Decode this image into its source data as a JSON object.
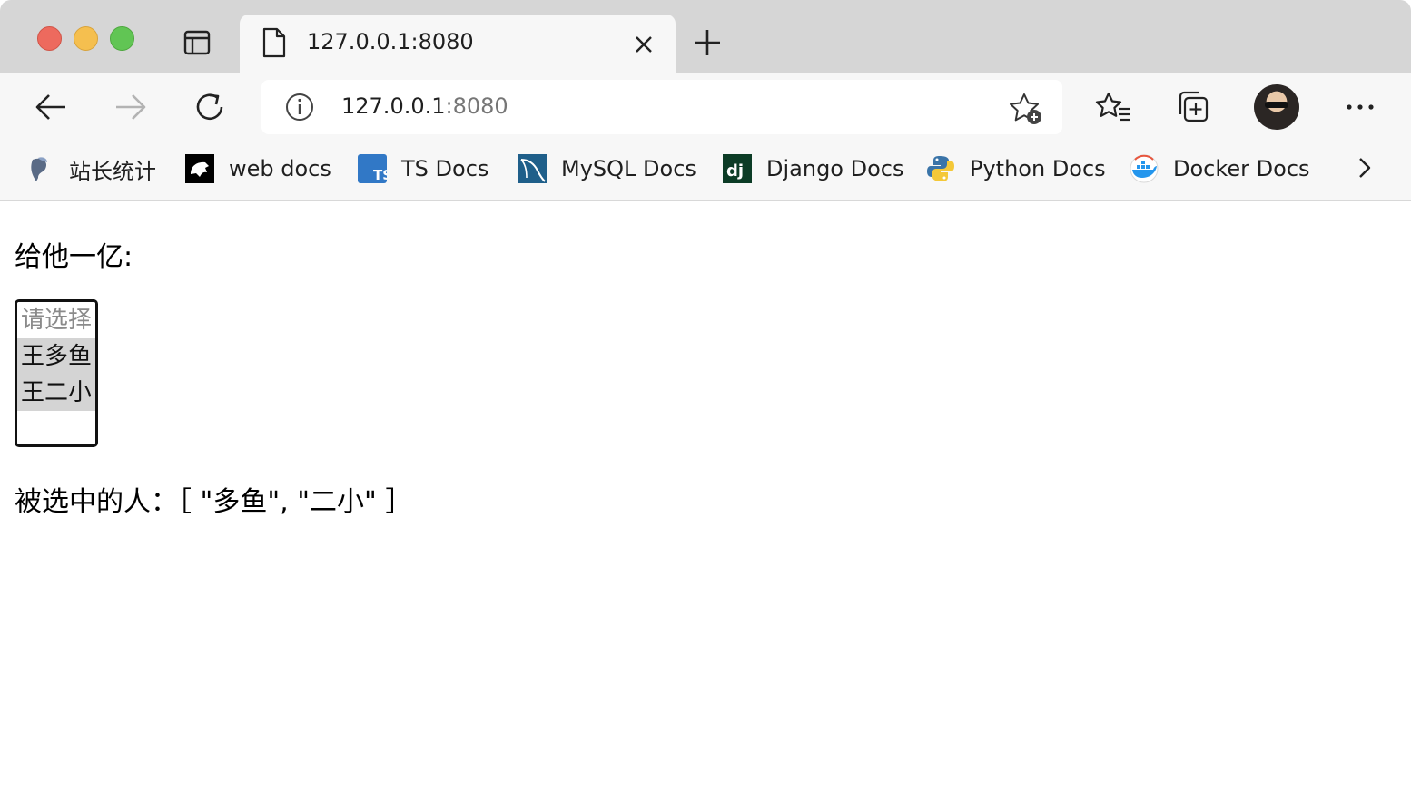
{
  "browser": {
    "tab": {
      "title": "127.0.0.1:8080"
    },
    "address_bar": {
      "host": "127.0.0.1",
      "port": ":8080"
    },
    "bookmarks": [
      {
        "label": "站长统计",
        "icon": "cnzz-icon"
      },
      {
        "label": "web docs",
        "icon": "mdn-icon"
      },
      {
        "label": "TS Docs",
        "icon": "typescript-icon"
      },
      {
        "label": "MySQL Docs",
        "icon": "mysql-icon"
      },
      {
        "label": "Django Docs",
        "icon": "django-icon"
      },
      {
        "label": "Python Docs",
        "icon": "python-icon"
      },
      {
        "label": "Docker Docs",
        "icon": "docker-icon"
      }
    ]
  },
  "page": {
    "prompt_label": "给他一亿:",
    "listbox": {
      "options": [
        {
          "label": "请选择",
          "state": "placeholder"
        },
        {
          "label": "王多鱼",
          "state": "selected"
        },
        {
          "label": "王二小",
          "state": "selected"
        }
      ]
    },
    "result": "被选中的人：［ \"多鱼\", \"二小\" ］"
  },
  "colors": {
    "tabstrip_bg": "#d6d6d6",
    "toolbar_bg": "#f7f7f7",
    "selected_option_bg": "#d4d4d4",
    "placeholder_text": "#8a8a8a",
    "close_red": "#ed6a5e",
    "minimize_yellow": "#f5bf4f",
    "maximize_green": "#61c554"
  }
}
